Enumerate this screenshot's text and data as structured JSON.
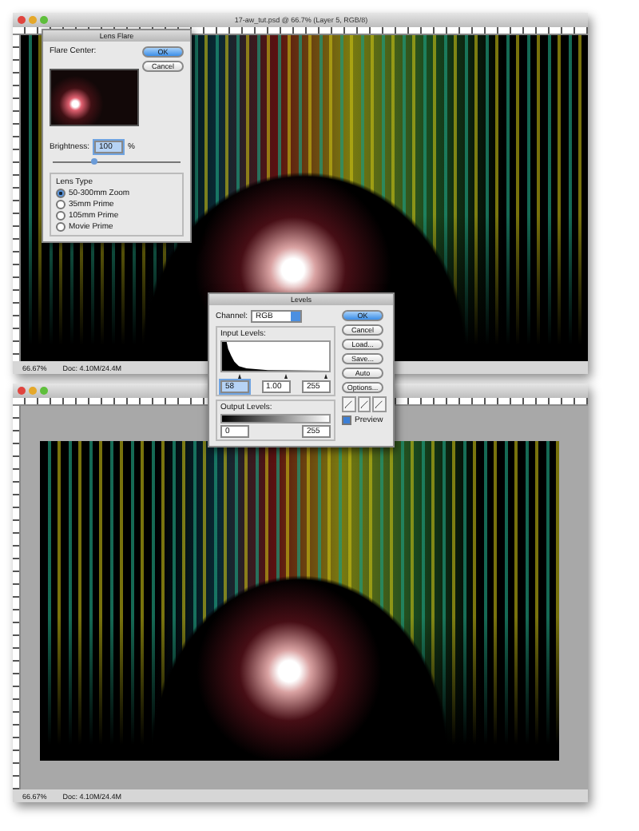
{
  "windows": [
    {
      "title": "17-aw_tut.psd @ 66.7% (Layer 5, RGB/8)",
      "zoom": "66.67%",
      "doc_info": "Doc: 4.10M/24.4M"
    },
    {
      "zoom": "66.67%",
      "doc_info": "Doc: 4.10M/24.4M"
    }
  ],
  "lens_flare": {
    "title": "Lens Flare",
    "flare_center_label": "Flare Center:",
    "buttons": [
      "OK",
      "Cancel"
    ],
    "brightness_label": "Brightness:",
    "brightness_value": "100",
    "brightness_unit": "%",
    "brightness_slider": {
      "level": 0.32
    },
    "lens_type_label": "Lens Type",
    "lens_types": [
      {
        "label": "50-300mm Zoom",
        "selected": true
      },
      {
        "label": "35mm Prime",
        "selected": false
      },
      {
        "label": "105mm Prime",
        "selected": false
      },
      {
        "label": "Movie Prime",
        "selected": false
      }
    ]
  },
  "levels": {
    "title": "Levels",
    "channel_label": "Channel:",
    "channel_value": "RGB",
    "input_label": "Input Levels:",
    "input_values": [
      "58",
      "1.00",
      "255"
    ],
    "input_thumbs": [
      {
        "level": 0.18
      },
      {
        "level": 0.6
      },
      {
        "level": 0.97
      }
    ],
    "output_label": "Output Levels:",
    "output_values": [
      "0",
      "255"
    ],
    "buttons": [
      "OK",
      "Cancel",
      "Load...",
      "Save...",
      "Auto",
      "Options..."
    ],
    "preview_label": "Preview",
    "preview_checked": true
  }
}
